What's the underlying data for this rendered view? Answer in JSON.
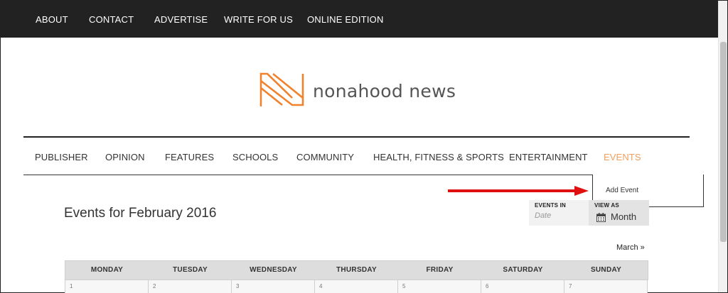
{
  "topnav": [
    "ABOUT",
    "CONTACT",
    "ADVERTISE",
    "WRITE FOR US",
    "ONLINE EDITION"
  ],
  "logo": {
    "text": "nonahood news",
    "icon": "n-logo-icon",
    "color": "#f0822d"
  },
  "mainnav": [
    "PUBLISHER",
    "OPINION",
    "FEATURES",
    "SCHOOLS",
    "COMMUNITY",
    "HEALTH, FITNESS & SPORTS",
    "ENTERTAINMENT",
    "EVENTS"
  ],
  "active_nav": "EVENTS",
  "dropdown": {
    "item": "Add Event"
  },
  "events": {
    "title": "Events for February 2016",
    "events_in_label": "EVENTS IN",
    "events_in_placeholder": "Date",
    "view_as_label": "VIEW AS",
    "view_as_value": "Month",
    "next_link": "March »"
  },
  "calendar": {
    "days": [
      "MONDAY",
      "TUESDAY",
      "WEDNESDAY",
      "THURSDAY",
      "FRIDAY",
      "SATURDAY",
      "SUNDAY"
    ],
    "first_week": [
      "1",
      "2",
      "3",
      "4",
      "5",
      "6",
      "7"
    ]
  },
  "colors": {
    "topbar": "#222222",
    "accent_active": "#f0a060",
    "arrow": "#e01010"
  }
}
